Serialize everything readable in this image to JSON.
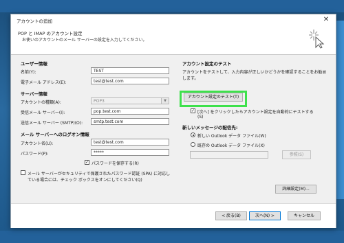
{
  "dialog": {
    "title": "アカウントの追加",
    "header_title": "POP と IMAP のアカウント設定",
    "header_subtitle": "お使いのアカウントのメール サーバーの設定を入力してください。"
  },
  "user_info": {
    "section_title": "ユーザー情報",
    "name_label": "名前(Y):",
    "name_value": "TEST",
    "email_label": "電子メール アドレス(E):",
    "email_value": "test@test.com"
  },
  "server_info": {
    "section_title": "サーバー情報",
    "account_type_label": "アカウントの種類(A):",
    "account_type_value": "POP3",
    "incoming_label": "受信メール サーバー(I):",
    "incoming_value": "pop.test.com",
    "outgoing_label": "送信メール サーバー (SMTP)(O):",
    "outgoing_value": "smtp.test.com"
  },
  "logon_info": {
    "section_title": "メール サーバーへのログオン情報",
    "account_name_label": "アカウント名(U):",
    "account_name_value": "test@test.com",
    "password_label": "パスワード(P):",
    "password_value": "*****",
    "remember_label": "パスワードを保存する(R)",
    "remember_checked": true,
    "spa_label_line1": "メール サーバーがセキュリティで保護されたパスワード認証 (SPA) に対応し",
    "spa_label_line2": "ている場合には、チェック ボックスをオンにしてください(Q)",
    "spa_checked": false
  },
  "test_settings": {
    "section_title": "アカウント設定のテスト",
    "description_line1": "アカウントをテストして、入力内容が正しいかどうかを確認することをお勧め",
    "description_line2": "します。",
    "test_button": "アカウント設定のテスト(T)",
    "auto_test_line1": "[次へ] をクリックしたらアカウント設定を自動的にテストする",
    "auto_test_line2": "(S)",
    "auto_test_checked": true
  },
  "delivery": {
    "section_title": "新しいメッセージの配信先:",
    "new_file_label": "新しい Outlook データ ファイル(W)",
    "existing_file_label": "既存の Outlook データ ファイル(X)",
    "selected": "new",
    "browse_button": "参照(S)"
  },
  "buttons": {
    "more_settings": "詳細設定(M)...",
    "back": "< 戻る(B)",
    "next": "次へ(N) >",
    "cancel": "キャンセル"
  },
  "icons": {
    "close": "close-icon",
    "header": "sparkle-cursor-icon",
    "dropdown": "chevron-down-icon",
    "check": "checkmark-icon"
  },
  "colors": {
    "highlight": "#3ee14c",
    "default_button_border": "#0078d7",
    "desktop": "#1d5789"
  }
}
